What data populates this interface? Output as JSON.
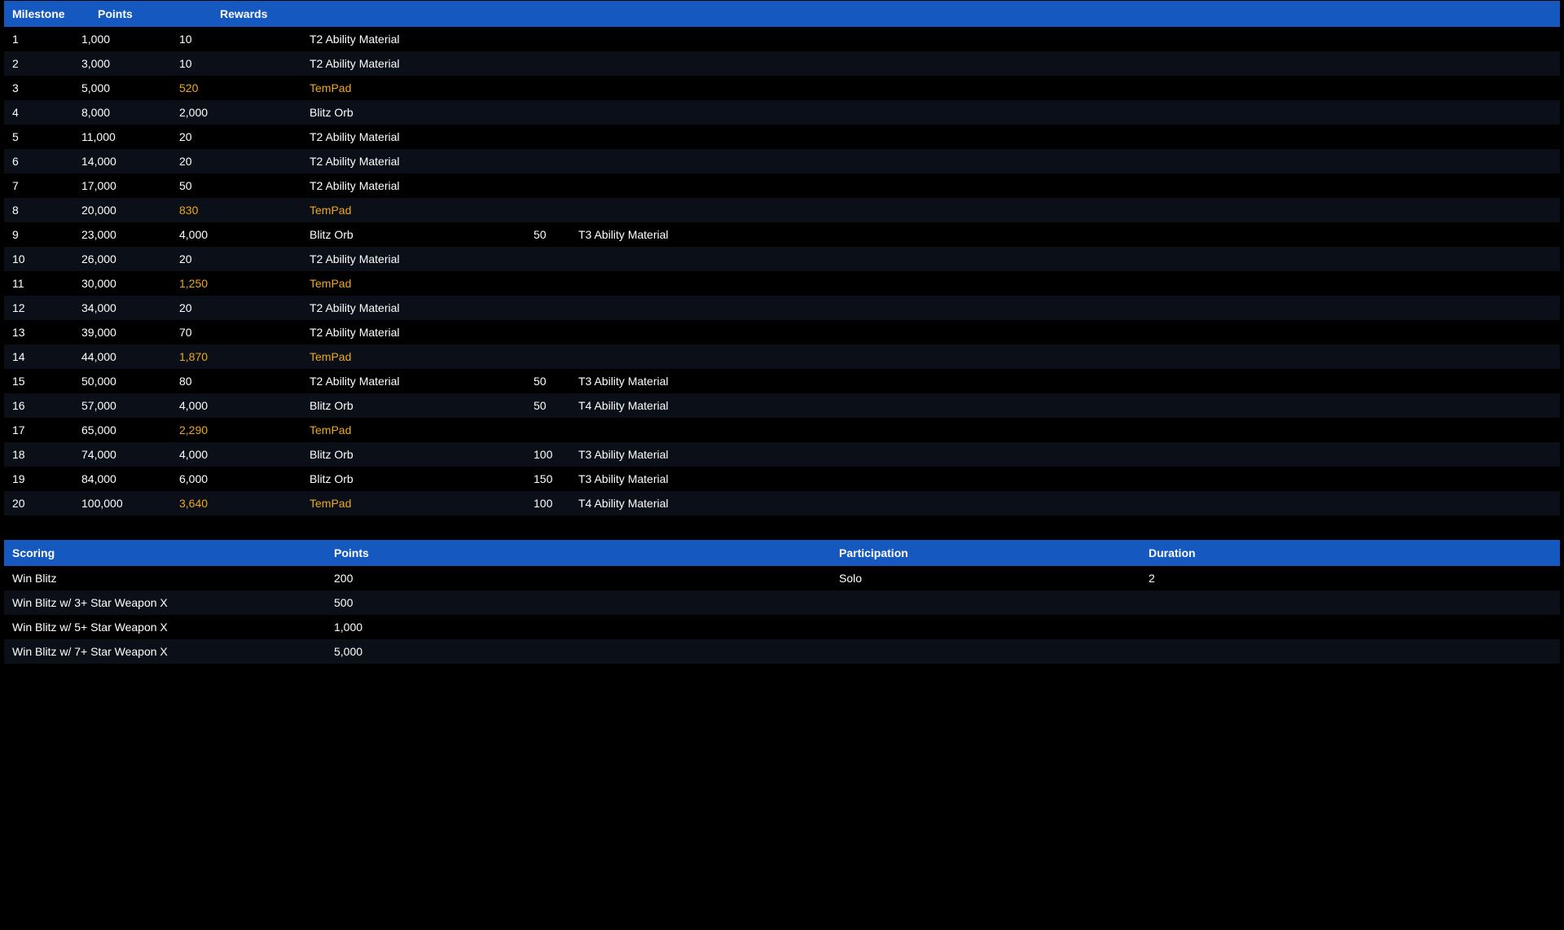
{
  "milestoneTable": {
    "headers": {
      "milestone": "Milestone",
      "points": "Points",
      "rewards": "Rewards"
    },
    "rows": [
      {
        "milestone": "1",
        "points": "1,000",
        "reward_qty": "10",
        "reward_name": "T2 Ability Material",
        "reward2_qty": "",
        "reward2_name": "",
        "highlight": false
      },
      {
        "milestone": "2",
        "points": "3,000",
        "reward_qty": "10",
        "reward_name": "T2 Ability Material",
        "reward2_qty": "",
        "reward2_name": "",
        "highlight": false
      },
      {
        "milestone": "3",
        "points": "5,000",
        "reward_qty": "520",
        "reward_name": "TemPad",
        "reward2_qty": "",
        "reward2_name": "",
        "highlight": true
      },
      {
        "milestone": "4",
        "points": "8,000",
        "reward_qty": "2,000",
        "reward_name": "Blitz Orb",
        "reward2_qty": "",
        "reward2_name": "",
        "highlight": false
      },
      {
        "milestone": "5",
        "points": "11,000",
        "reward_qty": "20",
        "reward_name": "T2 Ability Material",
        "reward2_qty": "",
        "reward2_name": "",
        "highlight": false
      },
      {
        "milestone": "6",
        "points": "14,000",
        "reward_qty": "20",
        "reward_name": "T2 Ability Material",
        "reward2_qty": "",
        "reward2_name": "",
        "highlight": false
      },
      {
        "milestone": "7",
        "points": "17,000",
        "reward_qty": "50",
        "reward_name": "T2 Ability Material",
        "reward2_qty": "",
        "reward2_name": "",
        "highlight": false
      },
      {
        "milestone": "8",
        "points": "20,000",
        "reward_qty": "830",
        "reward_name": "TemPad",
        "reward2_qty": "",
        "reward2_name": "",
        "highlight": true
      },
      {
        "milestone": "9",
        "points": "23,000",
        "reward_qty": "4,000",
        "reward_name": "Blitz Orb",
        "reward2_qty": "50",
        "reward2_name": "T3 Ability Material",
        "highlight": false
      },
      {
        "milestone": "10",
        "points": "26,000",
        "reward_qty": "20",
        "reward_name": "T2 Ability Material",
        "reward2_qty": "",
        "reward2_name": "",
        "highlight": false
      },
      {
        "milestone": "11",
        "points": "30,000",
        "reward_qty": "1,250",
        "reward_name": "TemPad",
        "reward2_qty": "",
        "reward2_name": "",
        "highlight": true
      },
      {
        "milestone": "12",
        "points": "34,000",
        "reward_qty": "20",
        "reward_name": "T2 Ability Material",
        "reward2_qty": "",
        "reward2_name": "",
        "highlight": false
      },
      {
        "milestone": "13",
        "points": "39,000",
        "reward_qty": "70",
        "reward_name": "T2 Ability Material",
        "reward2_qty": "",
        "reward2_name": "",
        "highlight": false
      },
      {
        "milestone": "14",
        "points": "44,000",
        "reward_qty": "1,870",
        "reward_name": "TemPad",
        "reward2_qty": "",
        "reward2_name": "",
        "highlight": true
      },
      {
        "milestone": "15",
        "points": "50,000",
        "reward_qty": "80",
        "reward_name": "T2 Ability Material",
        "reward2_qty": "50",
        "reward2_name": "T3 Ability Material",
        "highlight": false
      },
      {
        "milestone": "16",
        "points": "57,000",
        "reward_qty": "4,000",
        "reward_name": "Blitz Orb",
        "reward2_qty": "50",
        "reward2_name": "T4 Ability Material",
        "highlight": false
      },
      {
        "milestone": "17",
        "points": "65,000",
        "reward_qty": "2,290",
        "reward_name": "TemPad",
        "reward2_qty": "",
        "reward2_name": "",
        "highlight": true
      },
      {
        "milestone": "18",
        "points": "74,000",
        "reward_qty": "4,000",
        "reward_name": "Blitz Orb",
        "reward2_qty": "100",
        "reward2_name": "T3 Ability Material",
        "highlight": false
      },
      {
        "milestone": "19",
        "points": "84,000",
        "reward_qty": "6,000",
        "reward_name": "Blitz Orb",
        "reward2_qty": "150",
        "reward2_name": "T3 Ability Material",
        "highlight": false
      },
      {
        "milestone": "20",
        "points": "100,000",
        "reward_qty": "3,640",
        "reward_name": "TemPad",
        "reward2_qty": "100",
        "reward2_name": "T4 Ability Material",
        "highlight": true
      }
    ]
  },
  "scoringTable": {
    "headers": {
      "scoring": "Scoring",
      "points": "Points",
      "participation": "Participation",
      "duration": "Duration"
    },
    "rows": [
      {
        "scoring": "Win Blitz",
        "points": "200",
        "participation": "Solo",
        "duration": "2"
      },
      {
        "scoring": "Win Blitz w/ 3+ Star Weapon X",
        "points": "500",
        "participation": "",
        "duration": ""
      },
      {
        "scoring": "Win Blitz w/ 5+ Star Weapon X",
        "points": "1,000",
        "participation": "",
        "duration": ""
      },
      {
        "scoring": "Win Blitz w/ 7+ Star Weapon X",
        "points": "5,000",
        "participation": "",
        "duration": ""
      }
    ]
  }
}
